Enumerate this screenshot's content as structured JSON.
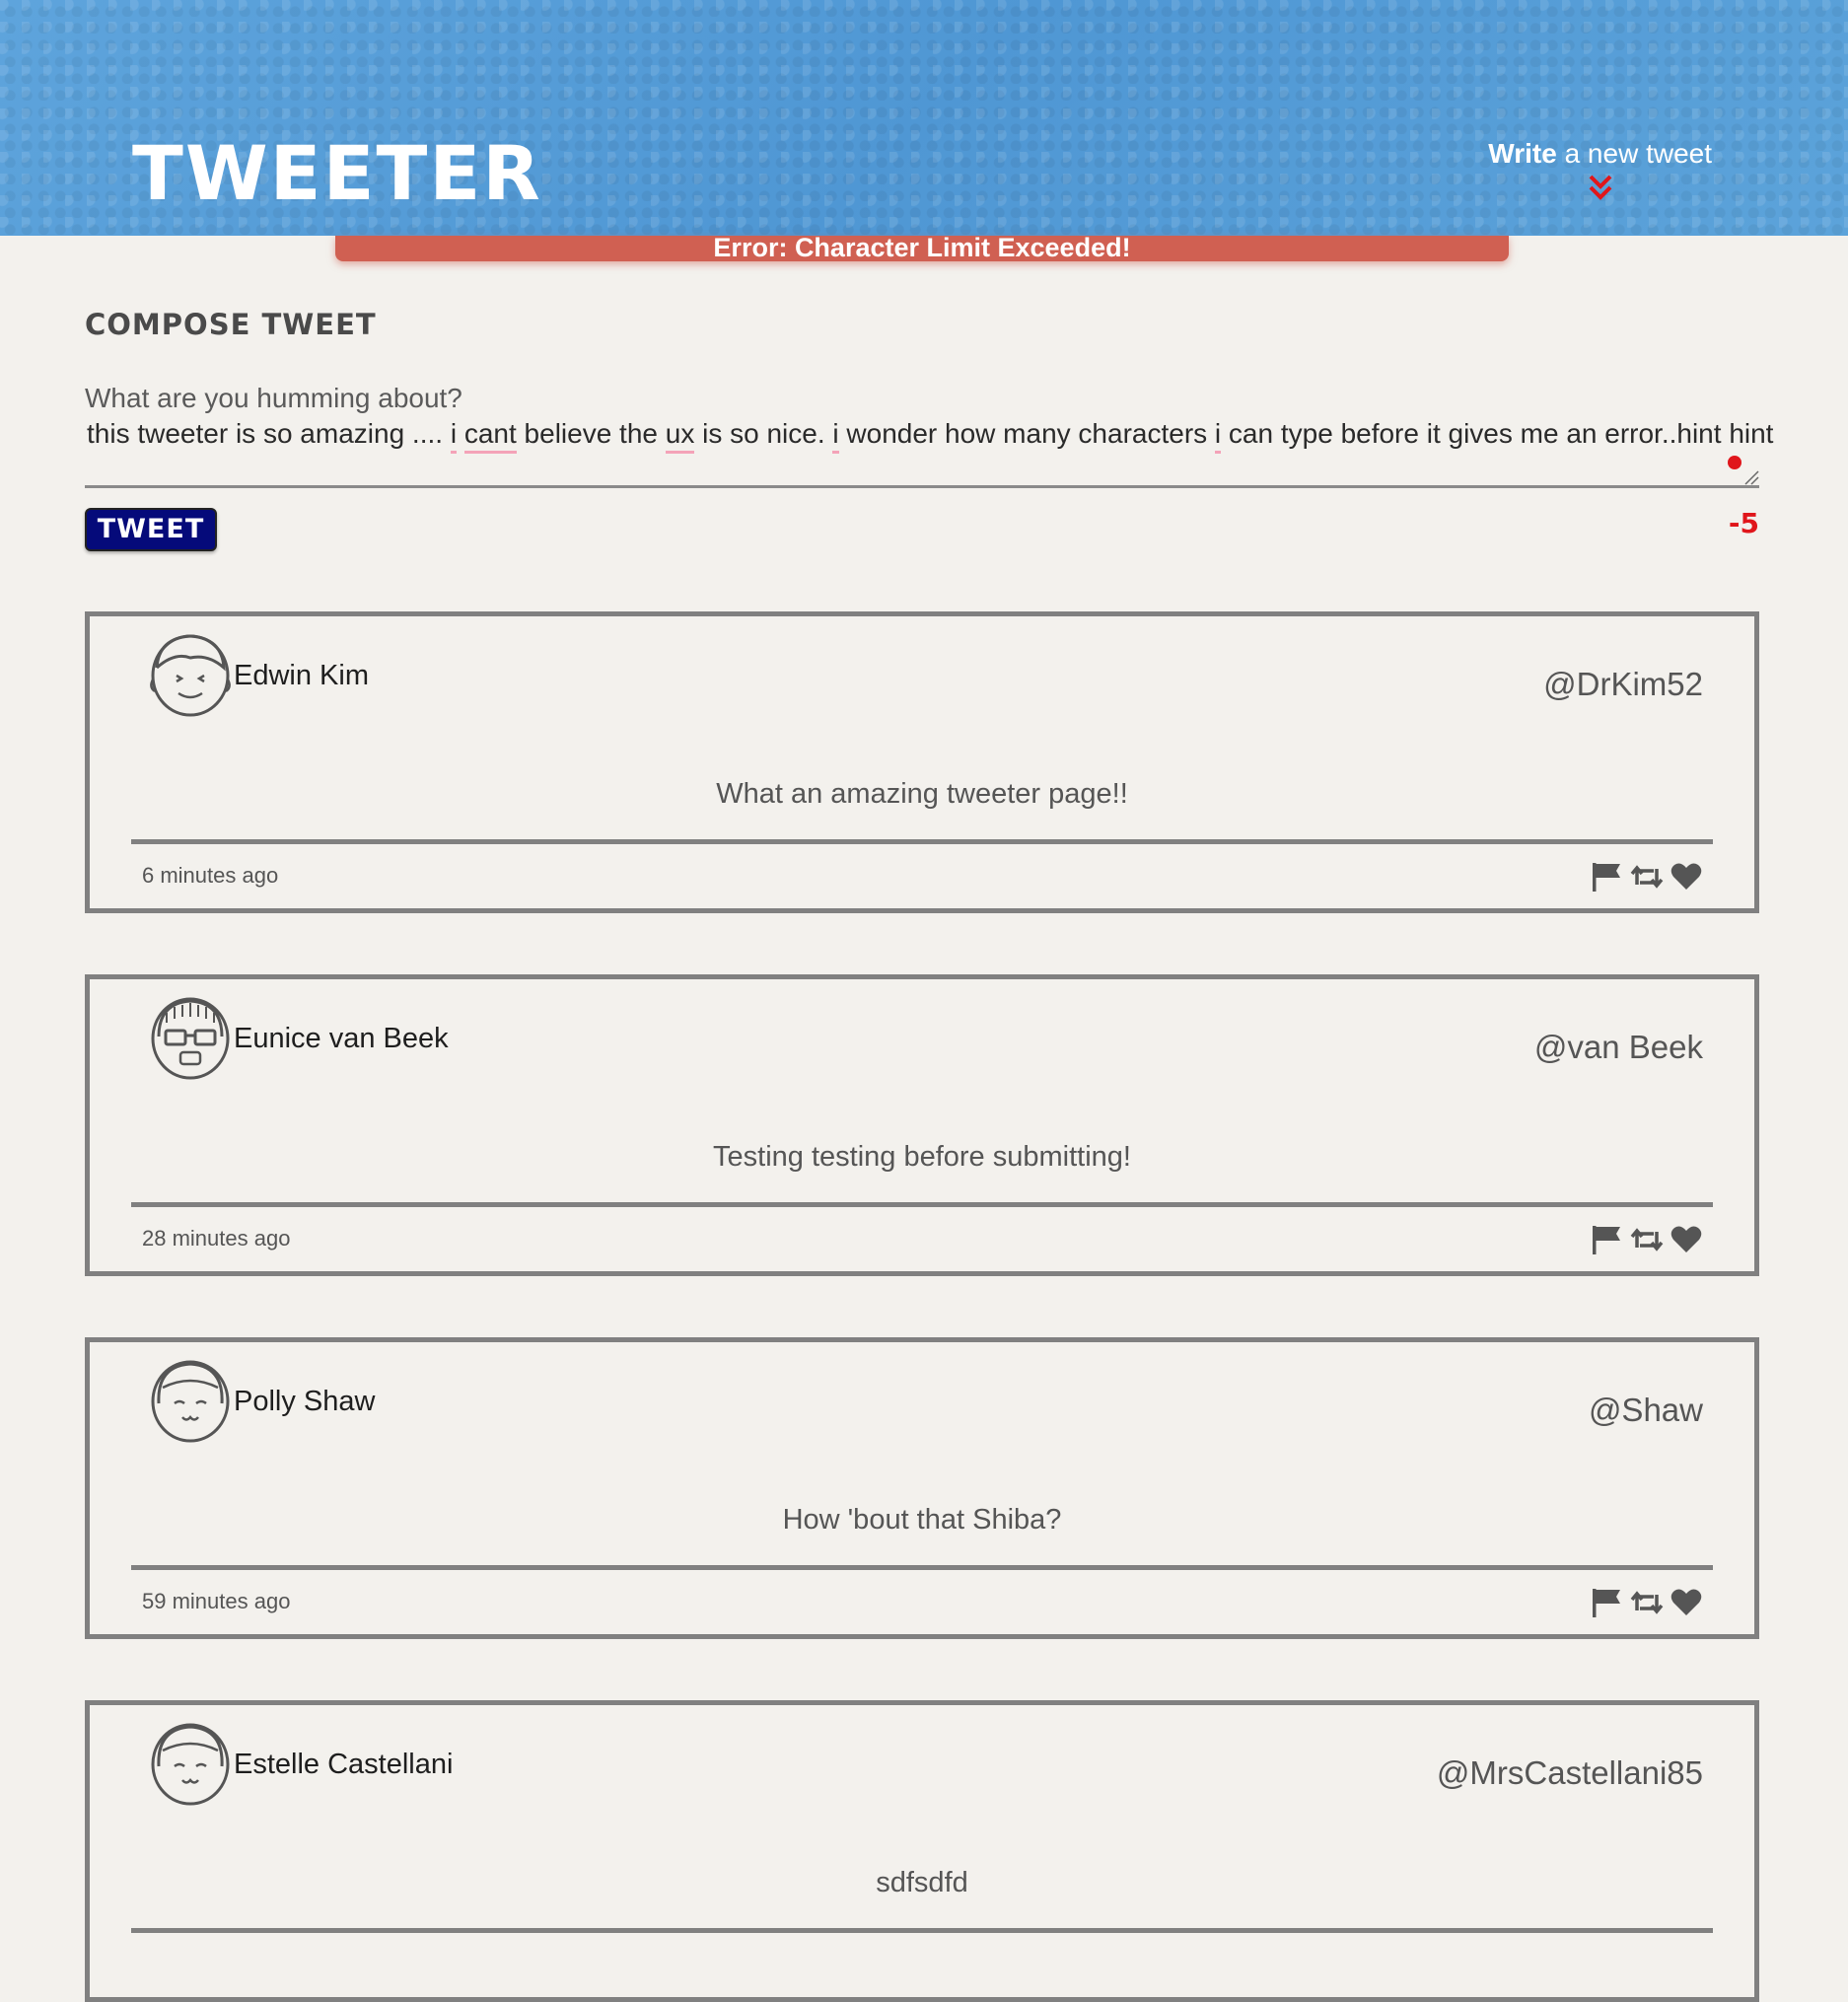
{
  "header": {
    "logo": "TWEETER",
    "write_bold": "Write",
    "write_rest": "a new tweet"
  },
  "error": {
    "message": "Error: Character Limit Exceeded!"
  },
  "compose": {
    "title": "COMPOSE TWEET",
    "placeholder": "What are you humming about?",
    "text_parts": [
      "this tweeter is so amazing .... ",
      "i",
      " ",
      "cant",
      " believe the ",
      "ux",
      " is so nice. ",
      "i",
      " wonder how many characters ",
      "i",
      " can type before it gives me an error..hint hint"
    ],
    "button_label": "TWEET",
    "counter": "-5"
  },
  "tweets": [
    {
      "name": "Edwin Kim",
      "handle": "@DrKim52",
      "body": "What an amazing tweeter page!!",
      "time": "6 minutes ago",
      "avatar_icon": "boy-face-icon"
    },
    {
      "name": "Eunice van Beek",
      "handle": "@van Beek",
      "body": "Testing testing before submitting!",
      "time": "28 minutes ago",
      "avatar_icon": "girl-glasses-face-icon"
    },
    {
      "name": "Polly Shaw",
      "handle": "@Shaw",
      "body": "How 'bout that Shiba?",
      "time": "59 minutes ago",
      "avatar_icon": "girl-bangs-face-icon"
    },
    {
      "name": "Estelle Castellani",
      "handle": "@MrsCastellani85",
      "body": "sdfsdfd",
      "time": "",
      "avatar_icon": "girl-bangs-face-icon"
    }
  ],
  "colors": {
    "header_blue": "#5a9fd8",
    "error_red": "#d06052",
    "button_navy": "#050a7a",
    "counter_red": "#e0161b",
    "background": "#f3f1ed"
  }
}
